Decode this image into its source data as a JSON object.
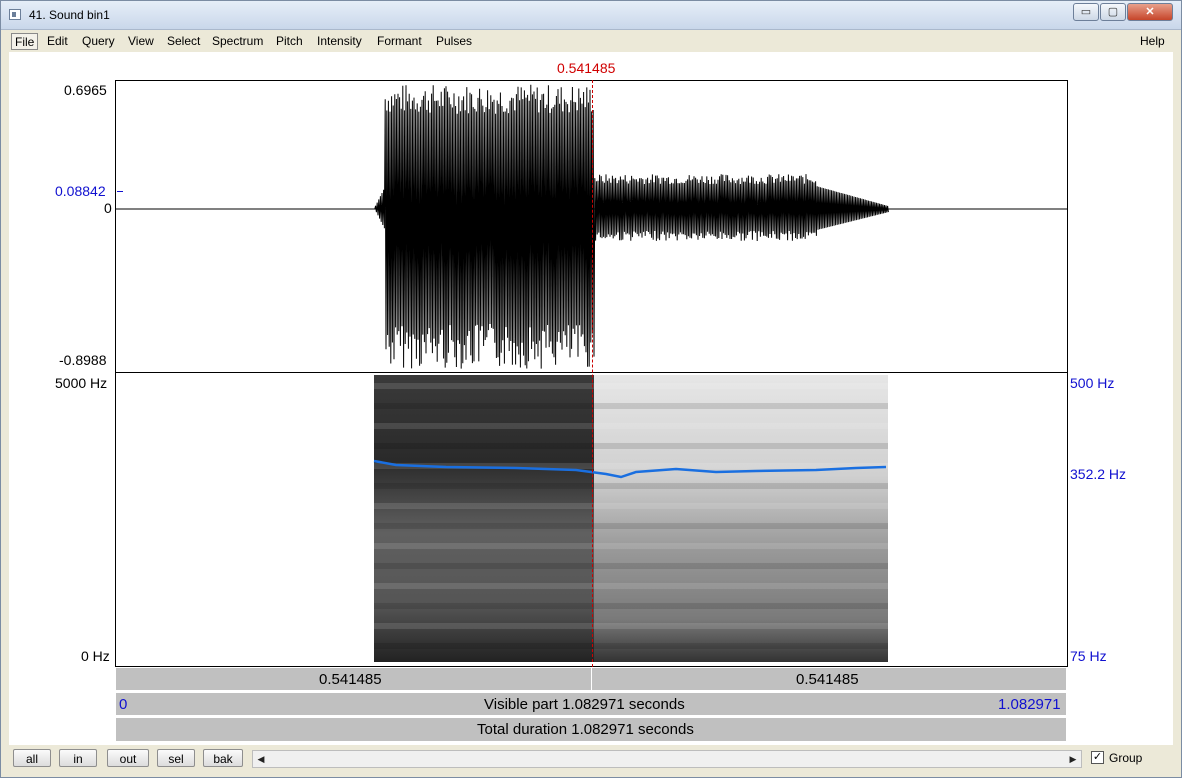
{
  "window": {
    "title": "41. Sound bin1",
    "min_glyph": "▭",
    "max_glyph": "▢",
    "close_glyph": "✕"
  },
  "menu": {
    "items": [
      "File",
      "Edit",
      "Query",
      "View",
      "Select",
      "Spectrum",
      "Pitch",
      "Intensity",
      "Formant",
      "Pulses"
    ],
    "help": "Help"
  },
  "cursor": {
    "time_label": "0.541485"
  },
  "waveform": {
    "max_label": "0.6965",
    "cursor_value_label": "0.08842",
    "zero_label": "0",
    "min_label": "-0.8988"
  },
  "spectrogram": {
    "top_label": "5000 Hz",
    "bottom_label": "0 Hz"
  },
  "pitch": {
    "top_label": "500 Hz",
    "value_label": "352.2 Hz",
    "bottom_label": "75 Hz"
  },
  "time_bars": {
    "left_segment": "0.541485",
    "right_segment": "0.541485",
    "visible_start": "0",
    "visible_text": "Visible part 1.082971 seconds",
    "visible_end": "1.082971",
    "total_text": "Total duration 1.082971 seconds"
  },
  "bottom": {
    "buttons": {
      "all": "all",
      "in": "in",
      "out": "out",
      "sel": "sel",
      "bak": "bak"
    },
    "scroll_left_glyph": "◀",
    "scroll_right_glyph": "▶",
    "group_check_glyph": "✓",
    "group_label": "Group"
  },
  "colors": {
    "cursor": "#cc0000",
    "pitch_line": "#1a6fe0",
    "axis_blue": "#1010d0"
  }
}
